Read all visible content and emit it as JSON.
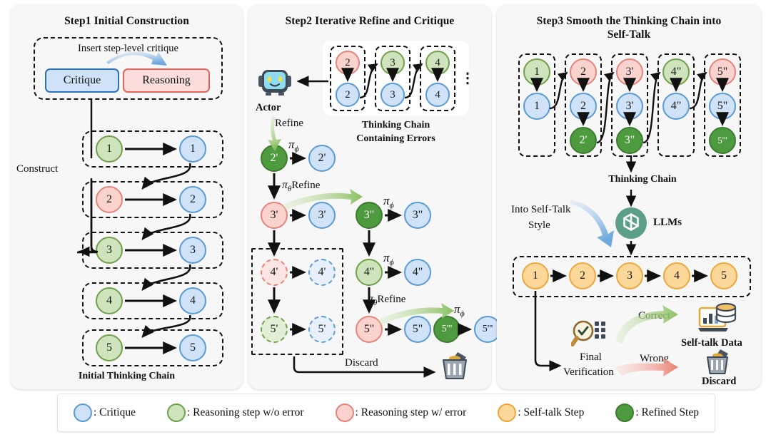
{
  "panels": {
    "p1": {
      "title": "Step1 Initial Construction",
      "insert_label": "Insert step-level critique",
      "critique_pill": "Critique",
      "reasoning_pill": "Reasoning",
      "construct_label": "Construct",
      "caption": "Initial Thinking Chain",
      "rows": [
        {
          "left": "1",
          "right": "1",
          "left_type": "good"
        },
        {
          "left": "2",
          "right": "2",
          "left_type": "bad"
        },
        {
          "left": "3",
          "right": "3",
          "left_type": "good"
        },
        {
          "left": "4",
          "right": "4",
          "left_type": "good"
        },
        {
          "left": "5",
          "right": "5",
          "left_type": "good"
        }
      ]
    },
    "p2": {
      "title": "Step2 Iterative Refine and Critique",
      "actor_label": "Actor",
      "refine_label": "Refine",
      "error_chain_caption": "Thinking Chain\nContaining Errors",
      "error_chain_caption_l1": "Thinking Chain",
      "error_chain_caption_l2": "Containing Errors",
      "ellipsis": "⋮",
      "error_chain": [
        {
          "top": "2",
          "top_type": "bad",
          "bottom": "2"
        },
        {
          "top": "3",
          "top_type": "good",
          "bottom": "3"
        },
        {
          "top": "4",
          "top_type": "good",
          "bottom": "4"
        }
      ],
      "pi_phi": "π",
      "pi_phi_sub": "ϕ",
      "pi_theta": "π",
      "pi_theta_sub": "θ",
      "refine_word": "Refine",
      "discard_label": "Discard",
      "nodes": {
        "r2_refined": "2'",
        "r2_critique": "2'",
        "r3_bad": "3'",
        "r3_critique": "3'",
        "r3_refined": "3\"",
        "r3b_critique": "3\"",
        "r4_bad": "4'",
        "r4_critique": "4'",
        "r4_good": "4\"",
        "r4b_critique": "4\"",
        "r5_good": "5'",
        "r5_critique": "5'",
        "r5_bad": "5\"",
        "r5b_critique": "5\"",
        "r5_refined": "5'''",
        "r5c_critique": "5'''"
      }
    },
    "p3": {
      "title_l1": "Step3 Smooth the Thinking Chain into",
      "title_l2": "Self-Talk",
      "chain_caption": "Thinking Chain",
      "into_style_l1": "Into Self-Talk",
      "into_style_l2": "Style",
      "llms_label": "LLMs",
      "final_verification_l1": "Final",
      "final_verification_l2": "Verification",
      "correct_label": "Correct",
      "wrong_label": "Wrong",
      "selftalk_data_label": "Self-talk Data",
      "discard_label": "Discard",
      "columns": [
        {
          "top": "1",
          "top_type": "good",
          "mid": "1",
          "bottom": null
        },
        {
          "top": "2",
          "top_type": "bad",
          "mid": "2",
          "bottom": "2'"
        },
        {
          "top": "3'",
          "top_type": "bad",
          "mid": "3'",
          "bottom": "3\""
        },
        {
          "top": "4\"",
          "top_type": "good",
          "mid": "4\"",
          "bottom": null
        },
        {
          "top": "5\"",
          "top_type": "bad",
          "mid": "5\"",
          "bottom": "5'''"
        }
      ],
      "selftalk_chain": [
        "1",
        "2",
        "3",
        "4",
        "5"
      ]
    }
  },
  "legend": [
    {
      "color_name": "critique",
      "label": ": Critique"
    },
    {
      "color_name": "good",
      "label": ": Reasoning step w/o error"
    },
    {
      "color_name": "bad",
      "label": ": Reasoning step w/ error"
    },
    {
      "color_name": "self",
      "label": ": Self-talk Step"
    },
    {
      "color_name": "refined",
      "label": ": Refined Step"
    }
  ],
  "colors": {
    "critique_fill": "#cfe2f7",
    "critique_stroke": "#5b9bd5",
    "good_fill": "#cfe3bd",
    "good_stroke": "#70a04a",
    "bad_fill": "#fad3cf",
    "bad_stroke": "#e8837a",
    "self_fill": "#fbd79a",
    "self_stroke": "#eda83c",
    "refined_fill": "#4e9a3e",
    "refined_stroke": "#3d7c31",
    "panel_bg": "#f7f7f7",
    "page_bg": "#ffffff"
  }
}
